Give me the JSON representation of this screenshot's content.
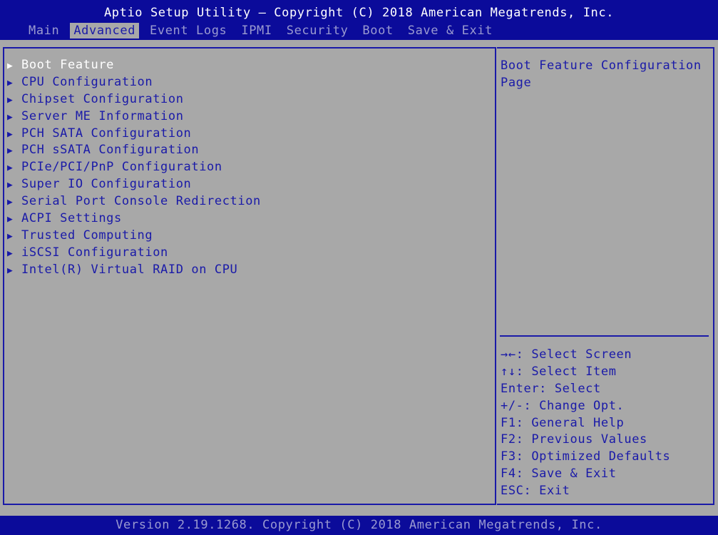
{
  "header": {
    "title": "Aptio Setup Utility – Copyright (C) 2018 American Megatrends, Inc.",
    "tabs": [
      "Main",
      "Advanced",
      "Event Logs",
      "IPMI",
      "Security",
      "Boot",
      "Save & Exit"
    ],
    "active_tab": "Advanced"
  },
  "menu": {
    "items": [
      "Boot Feature",
      "CPU Configuration",
      "Chipset Configuration",
      "Server ME Information",
      "PCH SATA Configuration",
      "PCH sSATA Configuration",
      "PCIe/PCI/PnP Configuration",
      "Super IO Configuration",
      "Serial Port Console Redirection",
      "ACPI Settings",
      "Trusted Computing",
      "iSCSI Configuration",
      "Intel(R) Virtual RAID on CPU"
    ],
    "selected_index": 0,
    "arrow_glyph": "▶"
  },
  "help": {
    "text": "Boot Feature Configuration Page",
    "keys": [
      "→←: Select Screen",
      "↑↓: Select Item",
      "Enter: Select",
      "+/-: Change Opt.",
      "F1: General Help",
      "F2: Previous Values",
      "F3: Optimized Defaults",
      "F4: Save & Exit",
      "ESC: Exit"
    ]
  },
  "footer": {
    "text": "Version 2.19.1268. Copyright (C) 2018 American Megatrends, Inc."
  },
  "colors": {
    "header_bg": "#0b0b9a",
    "panel_bg": "#a8a8a8",
    "text_blue": "#1a1aa8",
    "highlight": "#ffffff"
  }
}
